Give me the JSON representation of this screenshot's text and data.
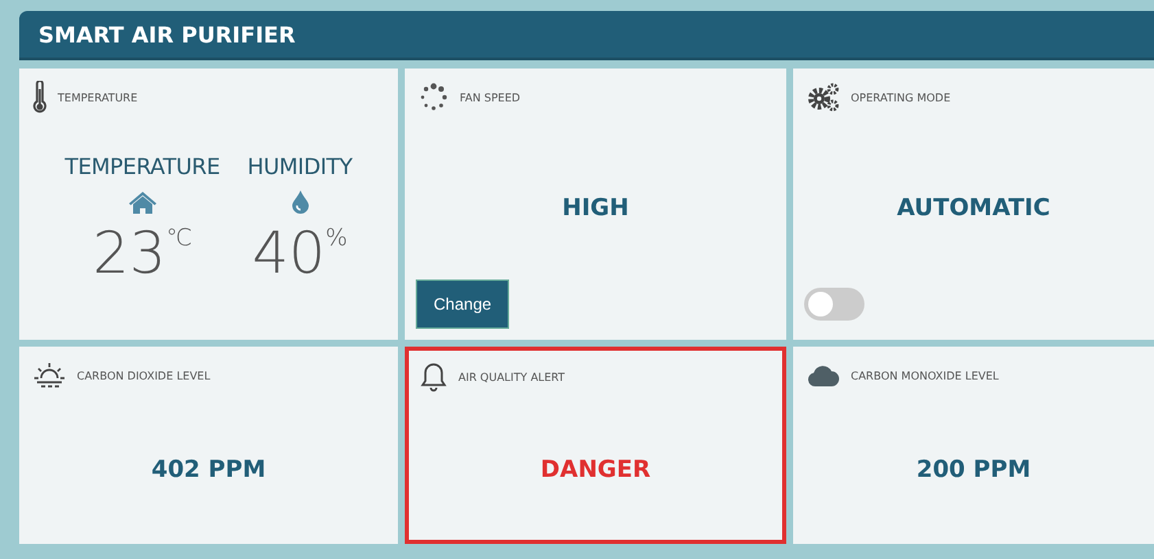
{
  "title": "SMART AIR PURIFIER",
  "cards": [
    {
      "kind": "climate",
      "title": "TEMPERATURE",
      "alert": false,
      "readings": [
        {
          "label": "TEMPERATURE",
          "value": "23",
          "unit": "℃"
        },
        {
          "label": "HUMIDITY",
          "value": "40",
          "unit": "%"
        }
      ]
    },
    {
      "kind": "value",
      "title": "FAN SPEED",
      "alert": false,
      "value": "HIGH",
      "button": "Change"
    },
    {
      "kind": "value",
      "title": "OPERATING MODE",
      "alert": false,
      "value": "AUTOMATIC",
      "toggle": {
        "on": false
      }
    },
    {
      "kind": "value",
      "title": "CARBON DIOXIDE LEVEL",
      "alert": false,
      "value": "402 PPM"
    },
    {
      "kind": "value",
      "title": "AIR QUALITY ALERT",
      "alert": true,
      "value": "DANGER"
    },
    {
      "kind": "value",
      "title": "CARBON MONOXIDE LEVEL",
      "alert": false,
      "value": "200 PPM"
    }
  ]
}
